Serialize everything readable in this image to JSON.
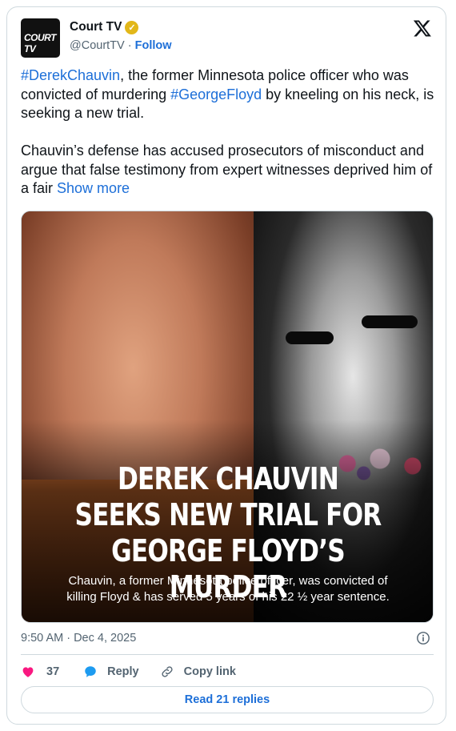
{
  "account": {
    "avatar_logo": "COURT TV",
    "display_name": "Court TV",
    "handle": "@CourtTV",
    "separator": " · ",
    "follow_label": "Follow"
  },
  "tweet": {
    "p1_tag1": "#DerekChauvin",
    "p1_text1": ", the former Minnesota police officer who was convicted of murdering ",
    "p1_tag2": "#GeorgeFloyd",
    "p1_text2": " by kneeling on his neck, is seeking a new trial.",
    "p2_text": "Chauvin’s defense has accused prosecutors of misconduct and argue that false testimony from expert witnesses deprived him of a fair ",
    "show_more": "Show more"
  },
  "media": {
    "headline_line1": "DEREK CHAUVIN",
    "headline_line2": "SEEKS NEW TRIAL FOR",
    "headline_line3": "GEORGE FLOYD’S MURDER",
    "caption_line1": "Chauvin, a former Minnesota police officer, was convicted of",
    "caption_line2": "killing Floyd & has served 5 years of his 22 ½ year sentence."
  },
  "meta": {
    "timestamp": "9:50 AM · Dec 4, 2025"
  },
  "actions": {
    "like_count": "37",
    "reply_label": "Reply",
    "copy_link_label": "Copy link"
  },
  "read_replies_label": "Read 21 replies",
  "colors": {
    "link": "#1d6fd8",
    "heart": "#f91880",
    "verified": "#e2b719",
    "secondary_text": "#536471",
    "border": "#cfd9de"
  },
  "icons": [
    "verified-badge-icon",
    "x-logo-icon",
    "info-icon",
    "heart-icon",
    "reply-bubble-icon",
    "link-icon"
  ]
}
